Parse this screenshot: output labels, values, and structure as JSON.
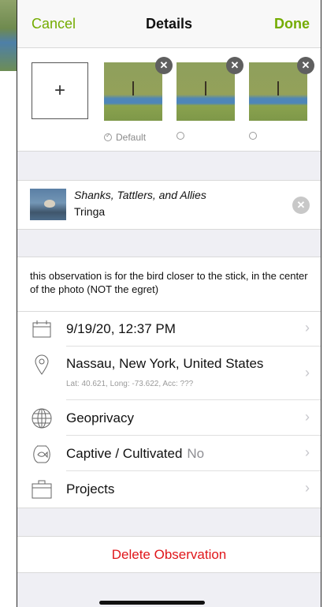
{
  "header": {
    "cancel_label": "Cancel",
    "title": "Details",
    "done_label": "Done"
  },
  "photos": {
    "add_symbol": "+",
    "remove_symbol": "✕",
    "items": [
      {
        "label": "Default",
        "is_default": true
      },
      {
        "label": "",
        "is_default": false
      },
      {
        "label": "",
        "is_default": false
      }
    ]
  },
  "taxon": {
    "common_name": "Shanks, Tattlers, and Allies",
    "scientific_name": "Tringa",
    "clear_symbol": "✕"
  },
  "notes": "this observation is for the bird closer to the stick, in the center of the photo (NOT the egret)",
  "rows": {
    "date": {
      "label": "9/19/20, 12:37 PM",
      "icon": "calendar-icon"
    },
    "location": {
      "label": "Nassau, New York, United States",
      "sub": "Lat: 40.621, Long: -73.622, Acc: ???",
      "icon": "location-pin-icon"
    },
    "geoprivacy": {
      "label": "Geoprivacy",
      "icon": "globe-icon"
    },
    "captive": {
      "label": "Captive / Cultivated",
      "value": "No",
      "icon": "fishbowl-icon"
    },
    "projects": {
      "label": "Projects",
      "icon": "briefcase-icon"
    }
  },
  "chevron": "›",
  "delete_label": "Delete Observation",
  "colors": {
    "accent": "#74ac00",
    "destructive": "#e0161a",
    "group_bg": "#efeff4"
  }
}
